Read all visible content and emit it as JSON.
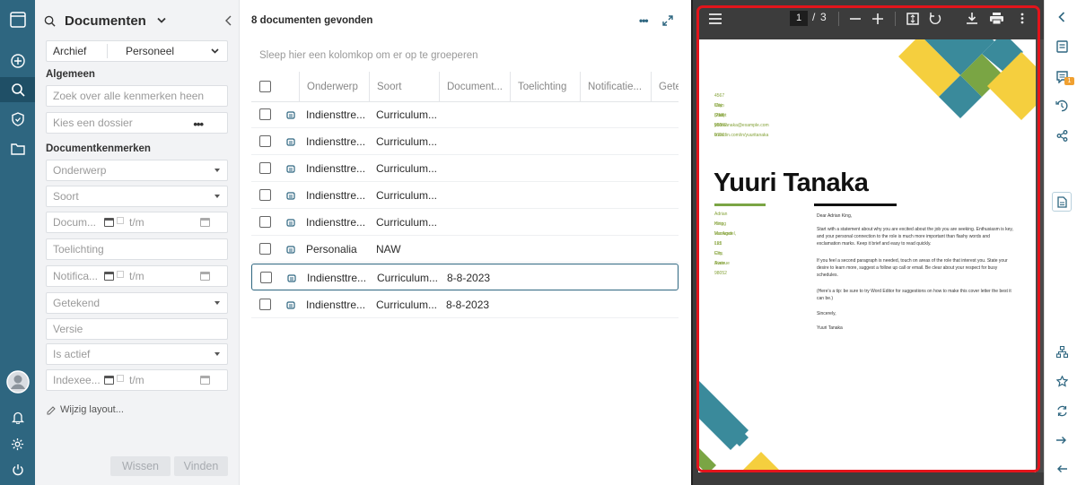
{
  "sidebar": {
    "title": "Documenten",
    "archief_label": "Archief",
    "archief_value": "Personeel",
    "section_algemeen": "Algemeen",
    "search_placeholder": "Zoek over alle kenmerken heen",
    "dossier_placeholder": "Kies een dossier",
    "section_kenmerken": "Documentkenmerken",
    "fields": {
      "onderwerp": "Onderwerp",
      "soort": "Soort",
      "documentdatum": "Docum...",
      "documentdatum_tm": "t/m",
      "toelichting": "Toelichting",
      "notificatie": "Notifica...",
      "notificatie_tm": "t/m",
      "getekend": "Getekend",
      "versie": "Versie",
      "is_actief": "Is actief",
      "indexeer": "Indexee...",
      "indexeer_tm": "t/m"
    },
    "edit_layout": "Wijzig layout...",
    "clear_button": "Wissen",
    "find_button": "Vinden"
  },
  "list": {
    "count_label": "8 documenten gevonden",
    "group_hint": "Sleep hier een kolomkop om er op te groeperen",
    "columns": [
      "Onderwerp",
      "Soort",
      "Document...",
      "Toelichting",
      "Notificatie...",
      "Gete"
    ],
    "rows": [
      {
        "onderwerp": "Indiensttre...",
        "soort": "Curriculum...",
        "datum": ""
      },
      {
        "onderwerp": "Indiensttre...",
        "soort": "Curriculum...",
        "datum": ""
      },
      {
        "onderwerp": "Indiensttre...",
        "soort": "Curriculum...",
        "datum": ""
      },
      {
        "onderwerp": "Indiensttre...",
        "soort": "Curriculum...",
        "datum": ""
      },
      {
        "onderwerp": "Indiensttre...",
        "soort": "Curriculum...",
        "datum": ""
      },
      {
        "onderwerp": "Personalia",
        "soort": "NAW",
        "datum": ""
      },
      {
        "onderwerp": "Indiensttre...",
        "soort": "Curriculum...",
        "datum": "8-8-2023"
      },
      {
        "onderwerp": "Indiensttre...",
        "soort": "Curriculum...",
        "datum": "8-8-2023"
      }
    ]
  },
  "viewer": {
    "page_current": "1",
    "page_separator": "/",
    "page_total": "3",
    "doc": {
      "contact": [
        "4567 Main Street",
        "City, State 98052",
        "(718) 555-0100",
        "yuuritanaka@example.com",
        "linkedin.com/in/yuuritanaka"
      ],
      "name": "Yuuri Tanaka",
      "recipient": [
        "Adrian King",
        "Hiring Manager",
        "VanArsdel, Ltd.",
        "123 Elm Avenue",
        "City, State 98052"
      ],
      "salutation": "Dear Adrian King,",
      "para1": "Start with a statement about why you are excited about the job you are seeking. Enthusiasm is key, and your personal connection to the role is much more important than flashy words and exclamation marks. Keep it brief and easy to read quickly.",
      "para2": "If you feel a second paragraph is needed, touch on areas of the role that interest you. State your desire to learn more, suggest a follow up call or email. Be clear about your respect for busy schedules.",
      "para3": "(Here's a tip: be sure to try Word Editor for suggestions on how to make this cover letter the best it can be.)",
      "closing": "Sincerely,",
      "signature": "Yuuri Tanaka"
    }
  },
  "colors": {
    "nav_bg": "#2e6680",
    "highlight_border": "#e3141b",
    "teal": "#3a8a9b",
    "yellow": "#f5cf3e",
    "green": "#7aa544"
  },
  "badge_count": "1"
}
